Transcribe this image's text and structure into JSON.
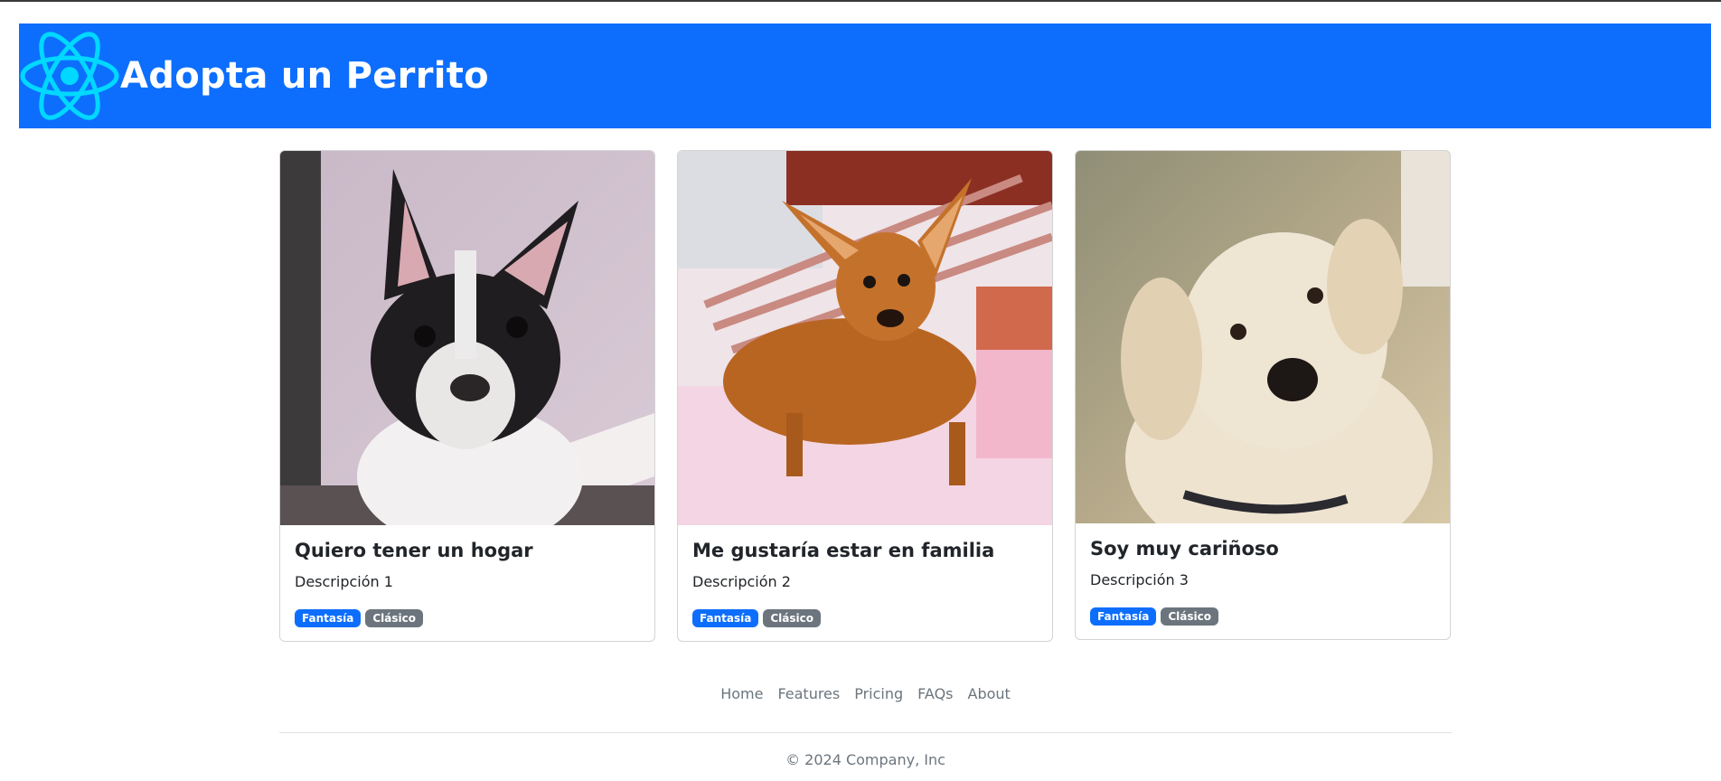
{
  "header": {
    "title": "Adopta un Perrito",
    "logo_icon": "react-atom-icon",
    "background": "#0d6efd",
    "logo_color": "#00d8ff"
  },
  "cards": [
    {
      "title": "Quiero tener un hogar",
      "description": "Descripción 1",
      "image": "french-bulldog-puppy-photo",
      "badges": [
        {
          "label": "Fantasía"
        },
        {
          "label": "Clásico"
        }
      ]
    },
    {
      "title": "Me gustaría estar en familia",
      "description": "Descripción 2",
      "image": "brown-chihuahua-on-bed-photo",
      "badges": [
        {
          "label": "Fantasía"
        },
        {
          "label": "Clásico"
        }
      ]
    },
    {
      "title": "Soy muy cariñoso",
      "description": "Descripción 3",
      "image": "labrador-retriever-photo",
      "badges": [
        {
          "label": "Fantasía"
        },
        {
          "label": "Clásico"
        }
      ]
    }
  ],
  "footer": {
    "nav": [
      "Home",
      "Features",
      "Pricing",
      "FAQs",
      "About"
    ],
    "copyright": "© 2024 Company, Inc"
  },
  "colors": {
    "primary": "#0d6efd",
    "secondary": "#6c757d",
    "muted_text": "#6c757d"
  }
}
